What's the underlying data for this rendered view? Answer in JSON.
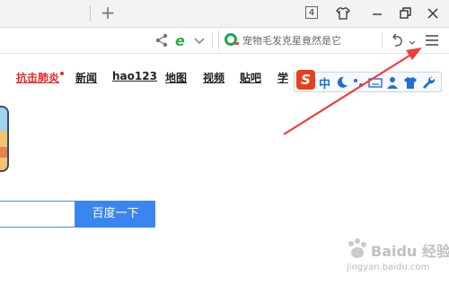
{
  "tabbar": {
    "new_tab_symbol": "+",
    "tab_count": "4"
  },
  "toolbar": {
    "search_placeholder": "宠物毛发克星竟然是它"
  },
  "nav_links": [
    {
      "label": "抗击肺炎",
      "color": "#e02b2b"
    },
    {
      "label": "新闻"
    },
    {
      "label": "hao123"
    },
    {
      "label": "地图"
    },
    {
      "label": "视频"
    },
    {
      "label": "贴吧"
    },
    {
      "label": "学"
    }
  ],
  "ime": {
    "logo": "S",
    "mode": "中"
  },
  "search": {
    "button_label": "百度一下",
    "accent_color": "#3a85f0"
  },
  "watermark": {
    "text": "Baidu 经验",
    "url": "jingyan.baidu.com"
  },
  "icons": [
    "share-icon",
    "ie-compat-icon",
    "chevron-down-icon",
    "undo-icon",
    "menu-icon",
    "skin-icon",
    "maximize-icon",
    "close-icon"
  ]
}
